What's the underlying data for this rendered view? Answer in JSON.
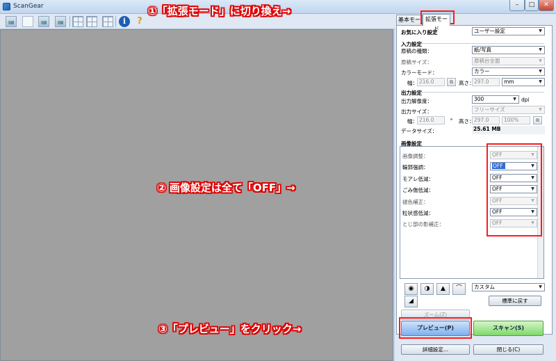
{
  "window": {
    "title": "ScanGear",
    "minimize": "–",
    "maximize": "□",
    "close": "✕"
  },
  "toolbar": {
    "icons": [
      "photo-icon",
      "document-icon",
      "image-icon",
      "image-icon",
      "image-icon",
      "grid-icon",
      "grid-icon",
      "grid-icon",
      "grid-icon",
      "info-icon",
      "help-icon"
    ],
    "info_glyph": "i",
    "help_glyph": "?"
  },
  "tabs": {
    "basic": "基本モード",
    "advanced": "拡張モード"
  },
  "favorites": {
    "label": "お気に入り設定",
    "value": "ユーザー設定"
  },
  "input_settings": {
    "title": "入力設定",
    "source_type_label": "原稿の種類：",
    "source_type_value": "紙/写真",
    "paper_size_label": "原稿サイズ：",
    "paper_size_value": "原稿台全面",
    "color_mode_label": "カラーモード：",
    "color_mode_value": "カラー",
    "width_label": "幅：",
    "width_value": "216.0",
    "height_label": "高さ：",
    "height_value": "297.0",
    "unit_value": "mm"
  },
  "output_settings": {
    "title": "出力設定",
    "resolution_label": "出力解像度：",
    "resolution_value": "300",
    "resolution_unit": "dpi",
    "output_size_label": "出力サイズ：",
    "output_size_value": "フリーサイズ",
    "width_label": "幅：",
    "width_value": "216.0",
    "height_label": "高さ：",
    "height_value": "297.0",
    "scale_value": "100%",
    "data_size_label": "データサイズ：",
    "data_size_value": "25.61 MB"
  },
  "image_settings": {
    "title": "画像設定",
    "rows": [
      {
        "label": "画像調整：",
        "value": "OFF",
        "enabled": false
      },
      {
        "label": "輪郭強調：",
        "value": "OFF",
        "enabled": true
      },
      {
        "label": "モアレ低減：",
        "value": "OFF",
        "enabled": true
      },
      {
        "label": "ごみ傷低減：",
        "value": "OFF",
        "enabled": true
      },
      {
        "label": "褪色補正：",
        "value": "OFF",
        "enabled": false
      },
      {
        "label": "粒状感低減：",
        "value": "OFF",
        "enabled": true
      },
      {
        "label": "とじ部の影補正：",
        "value": "OFF",
        "enabled": false
      }
    ]
  },
  "tone": {
    "preset_value": "カスタム",
    "reset_label": "標準に戻す"
  },
  "buttons": {
    "zoom": "ズーム(Z)",
    "preview": "プレビュー(P)",
    "scan": "スキャン(S)",
    "details": "詳細設定...",
    "close": "閉じる(C)"
  },
  "annotations": {
    "step1": "①「拡張モード」に切り換え→",
    "step2": "② 画像設定は全て「OFF」→",
    "step3": "③「プレビュー」をクリック→"
  },
  "colors": {
    "annotation_red": "#ff1a1a",
    "preview_blue": "#7fb0ee",
    "scan_green": "#7fd96a",
    "preview_area_gray": "#a0a0a0"
  }
}
